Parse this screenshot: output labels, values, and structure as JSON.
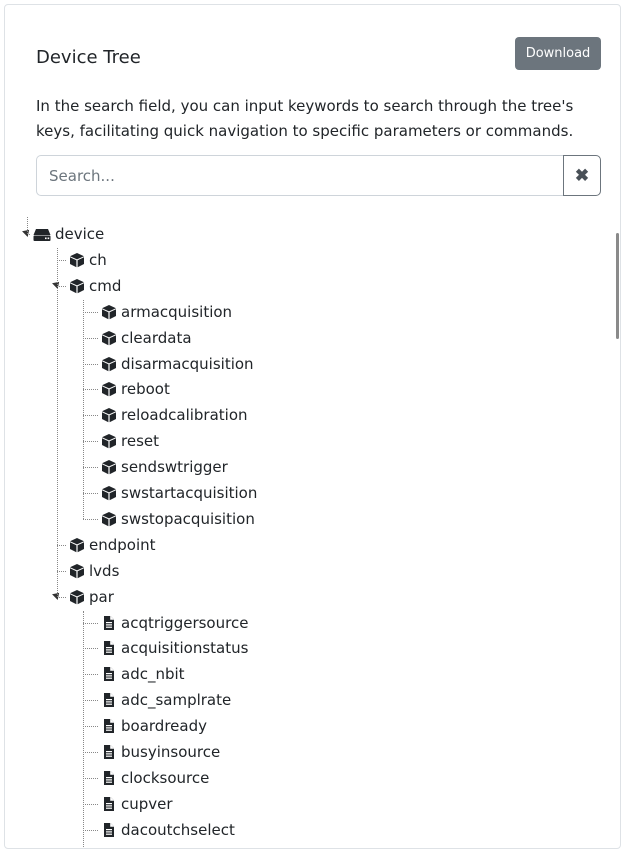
{
  "panel": {
    "title": "Device Tree",
    "download_label": "Download",
    "description": "In the search field, you can input keywords to search through the tree's keys, facilitating quick navigation to specific parameters or commands."
  },
  "search": {
    "placeholder": "Search...",
    "value": "",
    "clear_label": "✖"
  },
  "tree": {
    "root": {
      "label": "device",
      "icon": "drive-icon"
    },
    "nodes": [
      {
        "label": "ch",
        "icon": "cube-icon"
      },
      {
        "label": "cmd",
        "icon": "cube-icon"
      },
      {
        "label": "armacquisition",
        "icon": "cube-icon"
      },
      {
        "label": "cleardata",
        "icon": "cube-icon"
      },
      {
        "label": "disarmacquisition",
        "icon": "cube-icon"
      },
      {
        "label": "reboot",
        "icon": "cube-icon"
      },
      {
        "label": "reloadcalibration",
        "icon": "cube-icon"
      },
      {
        "label": "reset",
        "icon": "cube-icon"
      },
      {
        "label": "sendswtrigger",
        "icon": "cube-icon"
      },
      {
        "label": "swstartacquisition",
        "icon": "cube-icon"
      },
      {
        "label": "swstopacquisition",
        "icon": "cube-icon"
      },
      {
        "label": "endpoint",
        "icon": "cube-icon"
      },
      {
        "label": "lvds",
        "icon": "cube-icon"
      },
      {
        "label": "par",
        "icon": "cube-icon"
      },
      {
        "label": "acqtriggersource",
        "icon": "file-icon"
      },
      {
        "label": "acquisitionstatus",
        "icon": "file-icon"
      },
      {
        "label": "adc_nbit",
        "icon": "file-icon"
      },
      {
        "label": "adc_samplrate",
        "icon": "file-icon"
      },
      {
        "label": "boardready",
        "icon": "file-icon"
      },
      {
        "label": "busyinsource",
        "icon": "file-icon"
      },
      {
        "label": "clocksource",
        "icon": "file-icon"
      },
      {
        "label": "cupver",
        "icon": "file-icon"
      },
      {
        "label": "dacoutchselect",
        "icon": "file-icon"
      }
    ]
  }
}
